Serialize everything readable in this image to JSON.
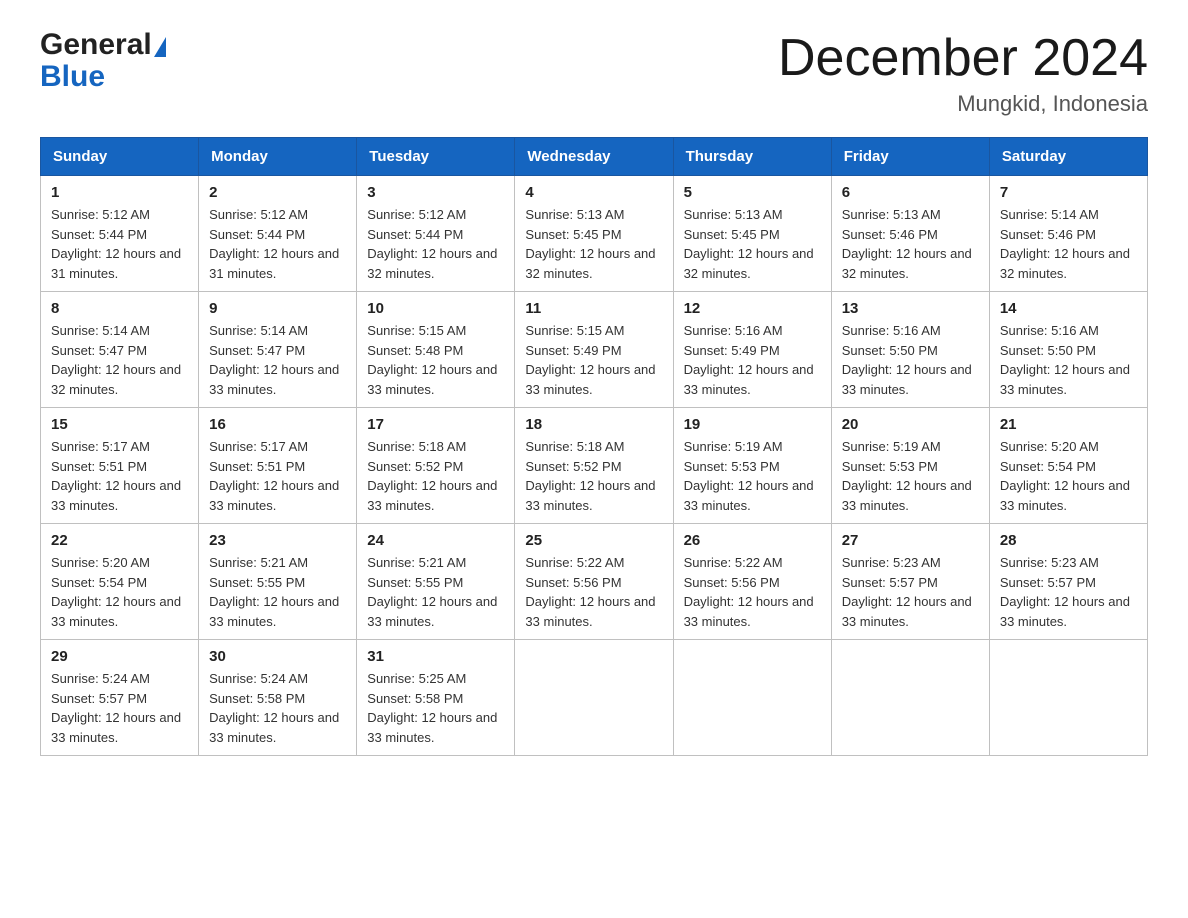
{
  "logo": {
    "general": "General",
    "blue": "Blue",
    "triangle": "▲"
  },
  "title": {
    "month_year": "December 2024",
    "location": "Mungkid, Indonesia"
  },
  "days_of_week": [
    "Sunday",
    "Monday",
    "Tuesday",
    "Wednesday",
    "Thursday",
    "Friday",
    "Saturday"
  ],
  "weeks": [
    [
      {
        "day": "1",
        "sunrise": "5:12 AM",
        "sunset": "5:44 PM",
        "daylight": "12 hours and 31 minutes."
      },
      {
        "day": "2",
        "sunrise": "5:12 AM",
        "sunset": "5:44 PM",
        "daylight": "12 hours and 31 minutes."
      },
      {
        "day": "3",
        "sunrise": "5:12 AM",
        "sunset": "5:44 PM",
        "daylight": "12 hours and 32 minutes."
      },
      {
        "day": "4",
        "sunrise": "5:13 AM",
        "sunset": "5:45 PM",
        "daylight": "12 hours and 32 minutes."
      },
      {
        "day": "5",
        "sunrise": "5:13 AM",
        "sunset": "5:45 PM",
        "daylight": "12 hours and 32 minutes."
      },
      {
        "day": "6",
        "sunrise": "5:13 AM",
        "sunset": "5:46 PM",
        "daylight": "12 hours and 32 minutes."
      },
      {
        "day": "7",
        "sunrise": "5:14 AM",
        "sunset": "5:46 PM",
        "daylight": "12 hours and 32 minutes."
      }
    ],
    [
      {
        "day": "8",
        "sunrise": "5:14 AM",
        "sunset": "5:47 PM",
        "daylight": "12 hours and 32 minutes."
      },
      {
        "day": "9",
        "sunrise": "5:14 AM",
        "sunset": "5:47 PM",
        "daylight": "12 hours and 33 minutes."
      },
      {
        "day": "10",
        "sunrise": "5:15 AM",
        "sunset": "5:48 PM",
        "daylight": "12 hours and 33 minutes."
      },
      {
        "day": "11",
        "sunrise": "5:15 AM",
        "sunset": "5:49 PM",
        "daylight": "12 hours and 33 minutes."
      },
      {
        "day": "12",
        "sunrise": "5:16 AM",
        "sunset": "5:49 PM",
        "daylight": "12 hours and 33 minutes."
      },
      {
        "day": "13",
        "sunrise": "5:16 AM",
        "sunset": "5:50 PM",
        "daylight": "12 hours and 33 minutes."
      },
      {
        "day": "14",
        "sunrise": "5:16 AM",
        "sunset": "5:50 PM",
        "daylight": "12 hours and 33 minutes."
      }
    ],
    [
      {
        "day": "15",
        "sunrise": "5:17 AM",
        "sunset": "5:51 PM",
        "daylight": "12 hours and 33 minutes."
      },
      {
        "day": "16",
        "sunrise": "5:17 AM",
        "sunset": "5:51 PM",
        "daylight": "12 hours and 33 minutes."
      },
      {
        "day": "17",
        "sunrise": "5:18 AM",
        "sunset": "5:52 PM",
        "daylight": "12 hours and 33 minutes."
      },
      {
        "day": "18",
        "sunrise": "5:18 AM",
        "sunset": "5:52 PM",
        "daylight": "12 hours and 33 minutes."
      },
      {
        "day": "19",
        "sunrise": "5:19 AM",
        "sunset": "5:53 PM",
        "daylight": "12 hours and 33 minutes."
      },
      {
        "day": "20",
        "sunrise": "5:19 AM",
        "sunset": "5:53 PM",
        "daylight": "12 hours and 33 minutes."
      },
      {
        "day": "21",
        "sunrise": "5:20 AM",
        "sunset": "5:54 PM",
        "daylight": "12 hours and 33 minutes."
      }
    ],
    [
      {
        "day": "22",
        "sunrise": "5:20 AM",
        "sunset": "5:54 PM",
        "daylight": "12 hours and 33 minutes."
      },
      {
        "day": "23",
        "sunrise": "5:21 AM",
        "sunset": "5:55 PM",
        "daylight": "12 hours and 33 minutes."
      },
      {
        "day": "24",
        "sunrise": "5:21 AM",
        "sunset": "5:55 PM",
        "daylight": "12 hours and 33 minutes."
      },
      {
        "day": "25",
        "sunrise": "5:22 AM",
        "sunset": "5:56 PM",
        "daylight": "12 hours and 33 minutes."
      },
      {
        "day": "26",
        "sunrise": "5:22 AM",
        "sunset": "5:56 PM",
        "daylight": "12 hours and 33 minutes."
      },
      {
        "day": "27",
        "sunrise": "5:23 AM",
        "sunset": "5:57 PM",
        "daylight": "12 hours and 33 minutes."
      },
      {
        "day": "28",
        "sunrise": "5:23 AM",
        "sunset": "5:57 PM",
        "daylight": "12 hours and 33 minutes."
      }
    ],
    [
      {
        "day": "29",
        "sunrise": "5:24 AM",
        "sunset": "5:57 PM",
        "daylight": "12 hours and 33 minutes."
      },
      {
        "day": "30",
        "sunrise": "5:24 AM",
        "sunset": "5:58 PM",
        "daylight": "12 hours and 33 minutes."
      },
      {
        "day": "31",
        "sunrise": "5:25 AM",
        "sunset": "5:58 PM",
        "daylight": "12 hours and 33 minutes."
      },
      null,
      null,
      null,
      null
    ]
  ],
  "labels": {
    "sunrise": "Sunrise:",
    "sunset": "Sunset:",
    "daylight": "Daylight:"
  }
}
